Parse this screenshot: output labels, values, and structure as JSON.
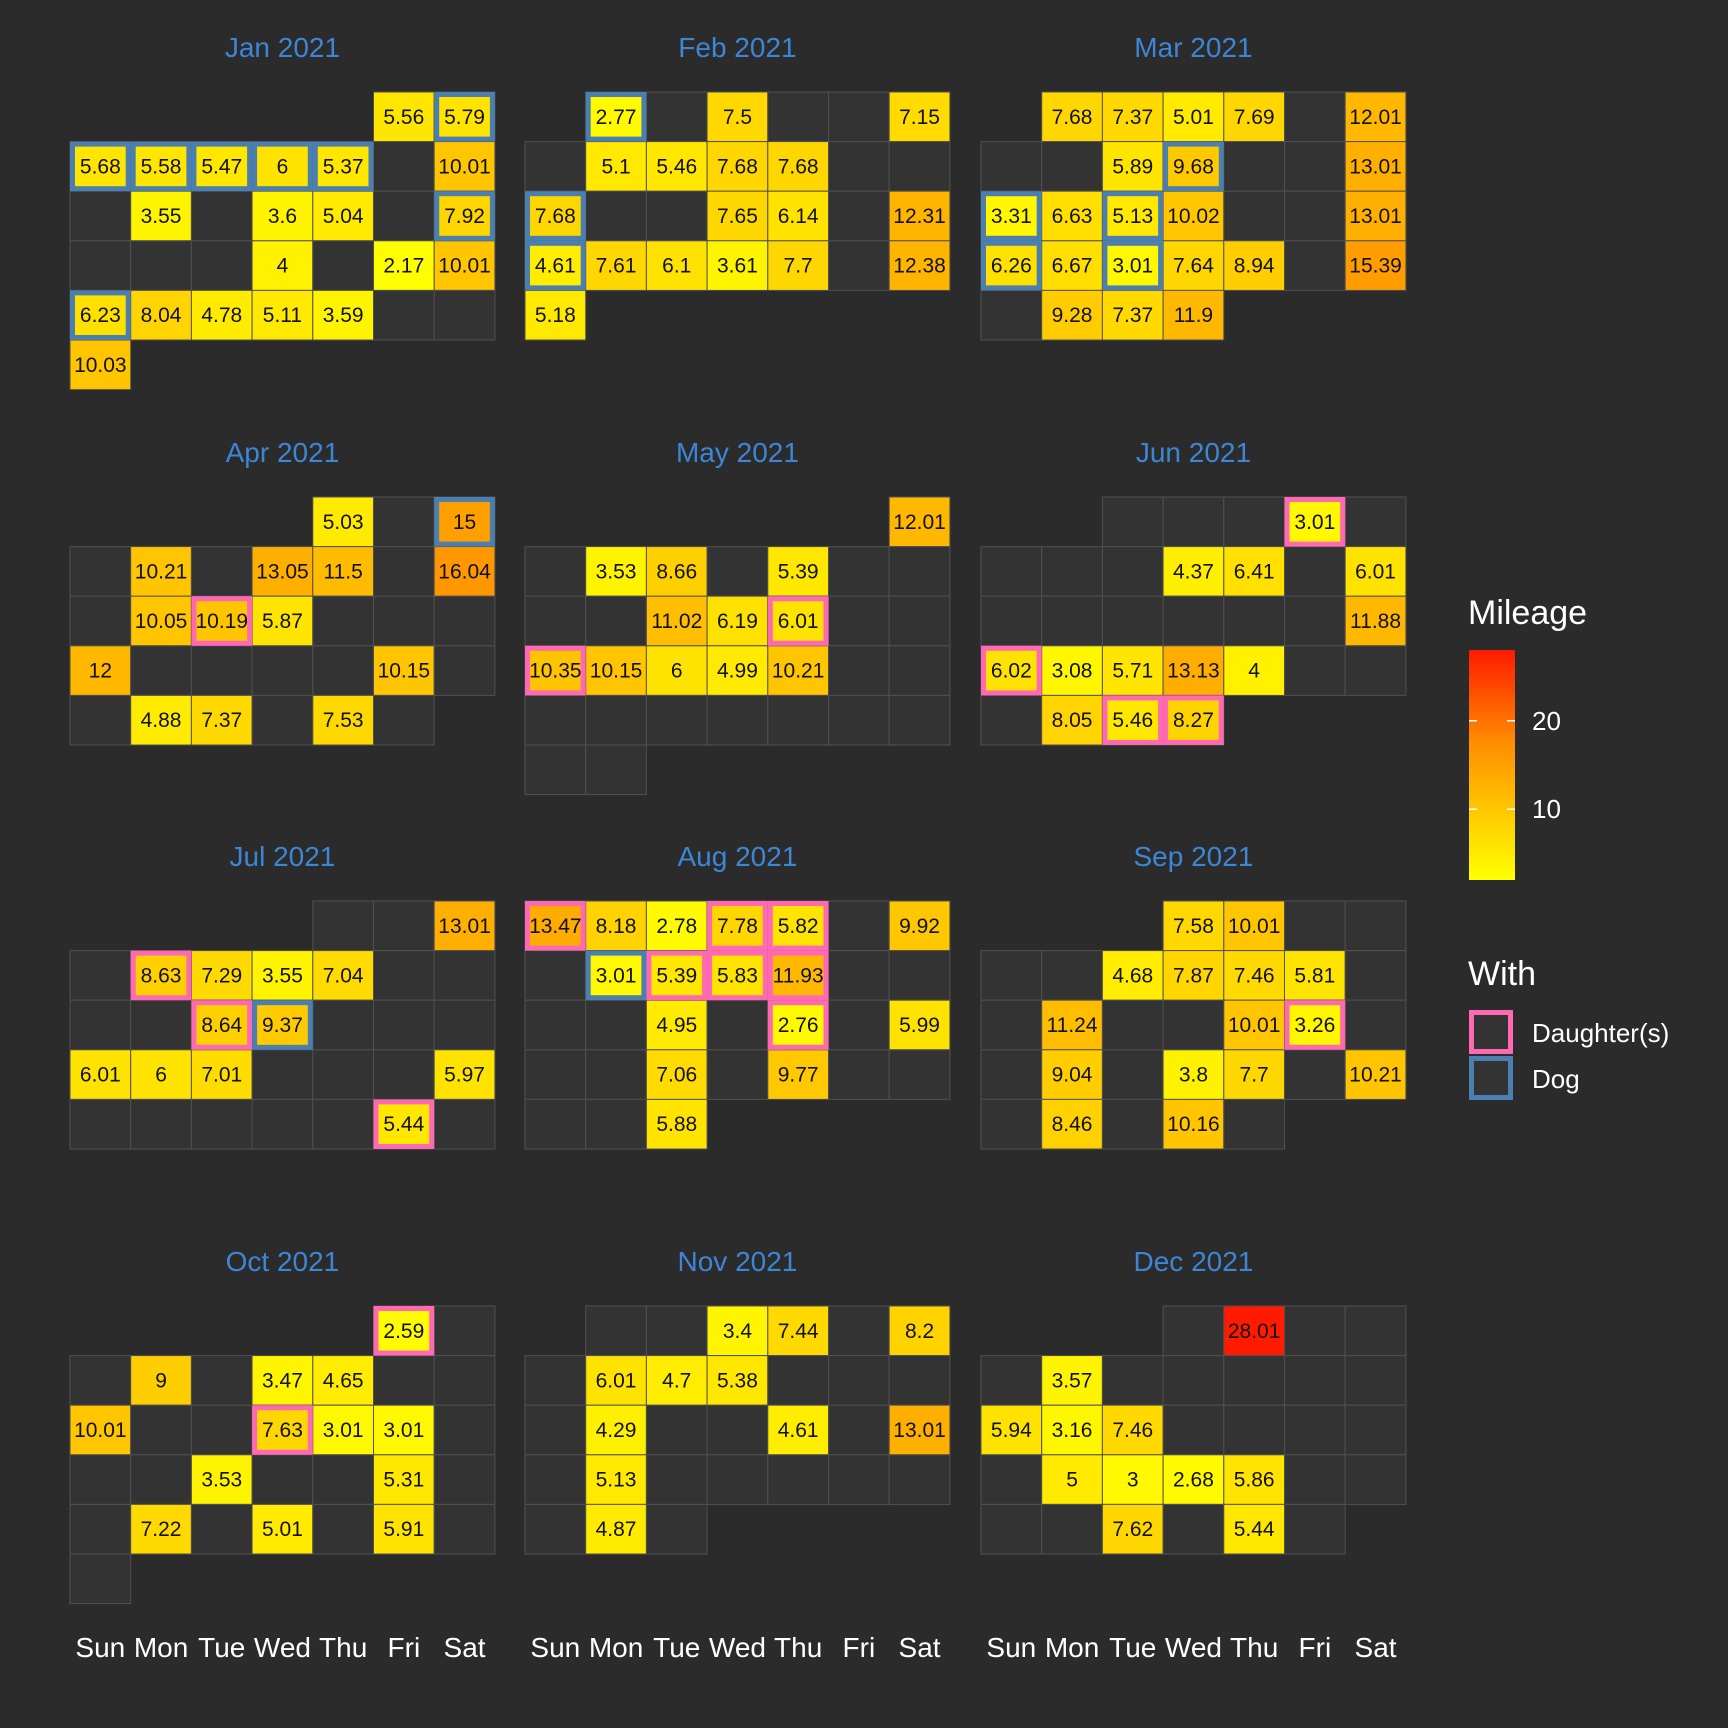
{
  "chart_data": {
    "type": "heatmap",
    "subtype": "calendar",
    "weekdays": [
      "Sun",
      "Mon",
      "Tue",
      "Wed",
      "Thu",
      "Fri",
      "Sat"
    ],
    "legend": {
      "mileage_title": "Mileage",
      "mileage_ticks": [
        10,
        20
      ],
      "mileage_range": [
        2,
        28
      ],
      "with_title": "With",
      "with_entries": [
        {
          "key": "D",
          "label": "Daughter(s)",
          "color": "#ff69b4"
        },
        {
          "key": "G",
          "label": "Dog",
          "color": "#4a7fb0"
        }
      ]
    },
    "colors": {
      "background": "#2b2b2b",
      "empty_cell": "#333333",
      "grid": "#505050",
      "title": "#3d86d6",
      "low": "#ffff00",
      "mid": "#ffa500",
      "high": "#ff0000"
    },
    "months": [
      {
        "title": "Jan 2021",
        "start": 5,
        "days": 31,
        "runs": {
          "1": [
            5.56,
            ""
          ],
          "2": [
            5.79,
            "G"
          ],
          "3": [
            5.68,
            "G"
          ],
          "4": [
            5.58,
            "G"
          ],
          "5": [
            5.47,
            "G"
          ],
          "6": [
            6,
            "G"
          ],
          "7": [
            5.37,
            "G"
          ],
          "9": [
            10.01,
            ""
          ],
          "11": [
            3.55,
            ""
          ],
          "13": [
            3.6,
            ""
          ],
          "14": [
            5.04,
            ""
          ],
          "16": [
            7.92,
            "G"
          ],
          "20": [
            4,
            ""
          ],
          "22": [
            2.17,
            ""
          ],
          "23": [
            10.01,
            ""
          ],
          "24": [
            6.23,
            "G"
          ],
          "25": [
            8.04,
            ""
          ],
          "26": [
            4.78,
            ""
          ],
          "27": [
            5.11,
            ""
          ],
          "28": [
            3.59,
            ""
          ],
          "31": [
            10.03,
            ""
          ]
        }
      },
      {
        "title": "Feb 2021",
        "start": 1,
        "days": 28,
        "runs": {
          "1": [
            2.77,
            "G"
          ],
          "3": [
            7.5,
            ""
          ],
          "6": [
            7.15,
            ""
          ],
          "8": [
            5.1,
            ""
          ],
          "9": [
            5.46,
            ""
          ],
          "10": [
            7.68,
            ""
          ],
          "11": [
            7.68,
            ""
          ],
          "14": [
            7.68,
            "G"
          ],
          "17": [
            7.65,
            ""
          ],
          "18": [
            6.14,
            ""
          ],
          "20": [
            12.31,
            ""
          ],
          "21": [
            4.61,
            "G"
          ],
          "22": [
            7.61,
            ""
          ],
          "23": [
            6.1,
            ""
          ],
          "24": [
            3.61,
            ""
          ],
          "25": [
            7.7,
            ""
          ],
          "27": [
            12.38,
            ""
          ],
          "28": [
            5.18,
            ""
          ]
        }
      },
      {
        "title": "Mar 2021",
        "start": 1,
        "days": 31,
        "runs": {
          "1": [
            7.68,
            ""
          ],
          "2": [
            7.37,
            ""
          ],
          "3": [
            5.01,
            ""
          ],
          "4": [
            7.69,
            ""
          ],
          "6": [
            12.01,
            ""
          ],
          "9": [
            5.89,
            ""
          ],
          "10": [
            9.68,
            "G"
          ],
          "13": [
            13.01,
            ""
          ],
          "14": [
            3.31,
            "G"
          ],
          "15": [
            6.63,
            ""
          ],
          "16": [
            5.13,
            "G"
          ],
          "17": [
            10.02,
            ""
          ],
          "20": [
            13.01,
            ""
          ],
          "21": [
            6.26,
            "G"
          ],
          "22": [
            6.67,
            ""
          ],
          "23": [
            3.01,
            "G"
          ],
          "24": [
            7.64,
            ""
          ],
          "25": [
            8.94,
            ""
          ],
          "27": [
            15.39,
            ""
          ],
          "29": [
            9.28,
            ""
          ],
          "30": [
            7.37,
            ""
          ],
          "31": [
            11.9,
            ""
          ]
        }
      },
      {
        "title": "Apr 2021",
        "start": 4,
        "days": 30,
        "runs": {
          "1": [
            5.03,
            ""
          ],
          "3": [
            15,
            "G"
          ],
          "5": [
            10.21,
            ""
          ],
          "7": [
            13.05,
            ""
          ],
          "8": [
            11.5,
            ""
          ],
          "10": [
            16.04,
            ""
          ],
          "12": [
            10.05,
            ""
          ],
          "13": [
            10.19,
            "D"
          ],
          "14": [
            5.87,
            ""
          ],
          "18": [
            12,
            ""
          ],
          "23": [
            10.15,
            ""
          ],
          "26": [
            4.88,
            ""
          ],
          "27": [
            7.37,
            ""
          ],
          "29": [
            7.53,
            ""
          ]
        }
      },
      {
        "title": "May 2021",
        "start": 6,
        "days": 31,
        "runs": {
          "1": [
            12.01,
            ""
          ],
          "3": [
            3.53,
            ""
          ],
          "4": [
            8.66,
            ""
          ],
          "6": [
            5.39,
            ""
          ],
          "11": [
            11.02,
            ""
          ],
          "12": [
            6.19,
            ""
          ],
          "13": [
            6.01,
            "D"
          ],
          "16": [
            10.35,
            "D"
          ],
          "17": [
            10.15,
            ""
          ],
          "18": [
            6,
            ""
          ],
          "19": [
            4.99,
            ""
          ],
          "20": [
            10.21,
            ""
          ]
        }
      },
      {
        "title": "Jun 2021",
        "start": 2,
        "days": 30,
        "runs": {
          "4": [
            3.01,
            "D"
          ],
          "9": [
            4.37,
            ""
          ],
          "10": [
            6.41,
            ""
          ],
          "12": [
            6.01,
            ""
          ],
          "19": [
            11.88,
            ""
          ],
          "20": [
            6.02,
            "D"
          ],
          "21": [
            3.08,
            ""
          ],
          "22": [
            5.71,
            ""
          ],
          "23": [
            13.13,
            ""
          ],
          "24": [
            4,
            ""
          ],
          "28": [
            8.05,
            ""
          ],
          "29": [
            5.46,
            "D"
          ],
          "30": [
            8.27,
            "D"
          ]
        }
      },
      {
        "title": "Jul 2021",
        "start": 4,
        "days": 31,
        "runs": {
          "3": [
            13.01,
            ""
          ],
          "5": [
            8.63,
            "D"
          ],
          "6": [
            7.29,
            ""
          ],
          "7": [
            3.55,
            ""
          ],
          "8": [
            7.04,
            ""
          ],
          "13": [
            8.64,
            "D"
          ],
          "14": [
            9.37,
            "G"
          ],
          "18": [
            6.01,
            ""
          ],
          "19": [
            6,
            ""
          ],
          "20": [
            7.01,
            ""
          ],
          "24": [
            5.97,
            ""
          ],
          "30": [
            5.44,
            "D"
          ]
        }
      },
      {
        "title": "Aug 2021",
        "start": 0,
        "days": 31,
        "runs": {
          "1": [
            13.47,
            "D"
          ],
          "2": [
            8.18,
            ""
          ],
          "3": [
            2.78,
            ""
          ],
          "4": [
            7.78,
            "D"
          ],
          "5": [
            5.82,
            "D"
          ],
          "7": [
            9.92,
            ""
          ],
          "9": [
            3.01,
            "G"
          ],
          "10": [
            5.39,
            "D"
          ],
          "11": [
            5.83,
            "D"
          ],
          "12": [
            11.93,
            "D"
          ],
          "17": [
            4.95,
            ""
          ],
          "19": [
            2.76,
            "D"
          ],
          "21": [
            5.99,
            ""
          ],
          "24": [
            7.06,
            ""
          ],
          "26": [
            9.77,
            ""
          ],
          "31": [
            5.88,
            ""
          ]
        }
      },
      {
        "title": "Sep 2021",
        "start": 3,
        "days": 30,
        "runs": {
          "1": [
            7.58,
            ""
          ],
          "2": [
            10.01,
            ""
          ],
          "7": [
            4.68,
            ""
          ],
          "8": [
            7.87,
            ""
          ],
          "9": [
            7.46,
            ""
          ],
          "10": [
            5.81,
            ""
          ],
          "13": [
            11.24,
            ""
          ],
          "16": [
            10.01,
            ""
          ],
          "17": [
            3.26,
            "D"
          ],
          "20": [
            9.04,
            ""
          ],
          "22": [
            3.8,
            ""
          ],
          "23": [
            7.7,
            ""
          ],
          "25": [
            10.21,
            ""
          ],
          "27": [
            8.46,
            ""
          ],
          "29": [
            10.16,
            ""
          ]
        }
      },
      {
        "title": "Oct 2021",
        "start": 5,
        "days": 31,
        "runs": {
          "1": [
            2.59,
            "D"
          ],
          "4": [
            9,
            ""
          ],
          "6": [
            3.47,
            ""
          ],
          "7": [
            4.65,
            ""
          ],
          "10": [
            10.01,
            ""
          ],
          "13": [
            7.63,
            "D"
          ],
          "14": [
            3.01,
            ""
          ],
          "15": [
            3.01,
            ""
          ],
          "19": [
            3.53,
            ""
          ],
          "22": [
            5.31,
            ""
          ],
          "25": [
            7.22,
            ""
          ],
          "27": [
            5.01,
            ""
          ],
          "29": [
            5.91,
            ""
          ]
        }
      },
      {
        "title": "Nov 2021",
        "start": 1,
        "days": 30,
        "runs": {
          "3": [
            3.4,
            ""
          ],
          "4": [
            7.44,
            ""
          ],
          "6": [
            8.2,
            ""
          ],
          "8": [
            6.01,
            ""
          ],
          "9": [
            4.7,
            ""
          ],
          "10": [
            5.38,
            ""
          ],
          "15": [
            4.29,
            ""
          ],
          "18": [
            4.61,
            ""
          ],
          "20": [
            13.01,
            ""
          ],
          "22": [
            5.13,
            ""
          ],
          "29": [
            4.87,
            ""
          ]
        }
      },
      {
        "title": "Dec 2021",
        "start": 3,
        "days": 31,
        "runs": {
          "2": [
            28.01,
            ""
          ],
          "6": [
            3.57,
            ""
          ],
          "12": [
            5.94,
            ""
          ],
          "13": [
            3.16,
            ""
          ],
          "14": [
            7.46,
            ""
          ],
          "20": [
            5,
            ""
          ],
          "21": [
            3,
            ""
          ],
          "22": [
            2.68,
            ""
          ],
          "23": [
            5.86,
            ""
          ],
          "28": [
            7.62,
            ""
          ],
          "30": [
            5.44,
            ""
          ]
        }
      }
    ]
  }
}
